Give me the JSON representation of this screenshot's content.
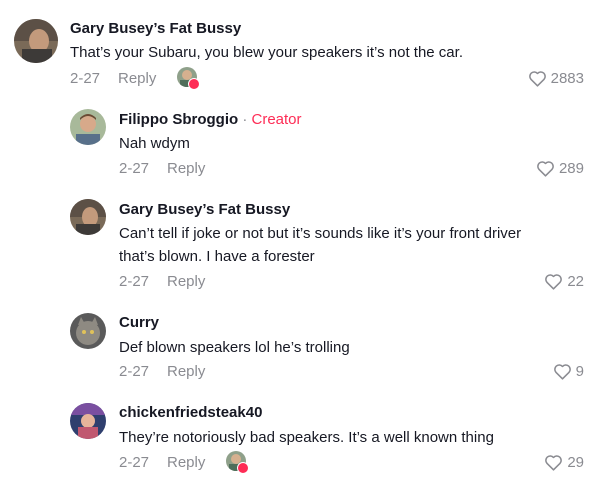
{
  "comments": [
    {
      "author": "Gary Busey’s Fat Bussy",
      "text": "That’s your Subaru, you blew your speakers it’s not the car.",
      "date": "2-27",
      "reply": "Reply",
      "likes": "2883",
      "creator_liked": true
    },
    {
      "author": "Filippo Sbroggio",
      "badge_sep": "·",
      "badge": "Creator",
      "text": "Nah wdym",
      "date": "2-27",
      "reply": "Reply",
      "likes": "289"
    },
    {
      "author": "Gary Busey’s Fat Bussy",
      "text_line1": "Can’t tell if joke or not but it’s sounds like it’s your front driver",
      "text_line2": "that’s blown. I have a forester",
      "date": "2-27",
      "reply": "Reply",
      "likes": "22"
    },
    {
      "author": "Curry",
      "text": "Def blown speakers lol he’s trolling",
      "date": "2-27",
      "reply": "Reply",
      "likes": "9"
    },
    {
      "author": "chickenfriedsteak40",
      "text": "They’re notoriously bad speakers. It’s a well known thing",
      "date": "2-27",
      "reply": "Reply",
      "likes": "29",
      "creator_liked": true
    }
  ],
  "colors": {
    "creator_accent": "#fe2c55",
    "meta_text": "#8a8b91",
    "primary_text": "#161823"
  }
}
